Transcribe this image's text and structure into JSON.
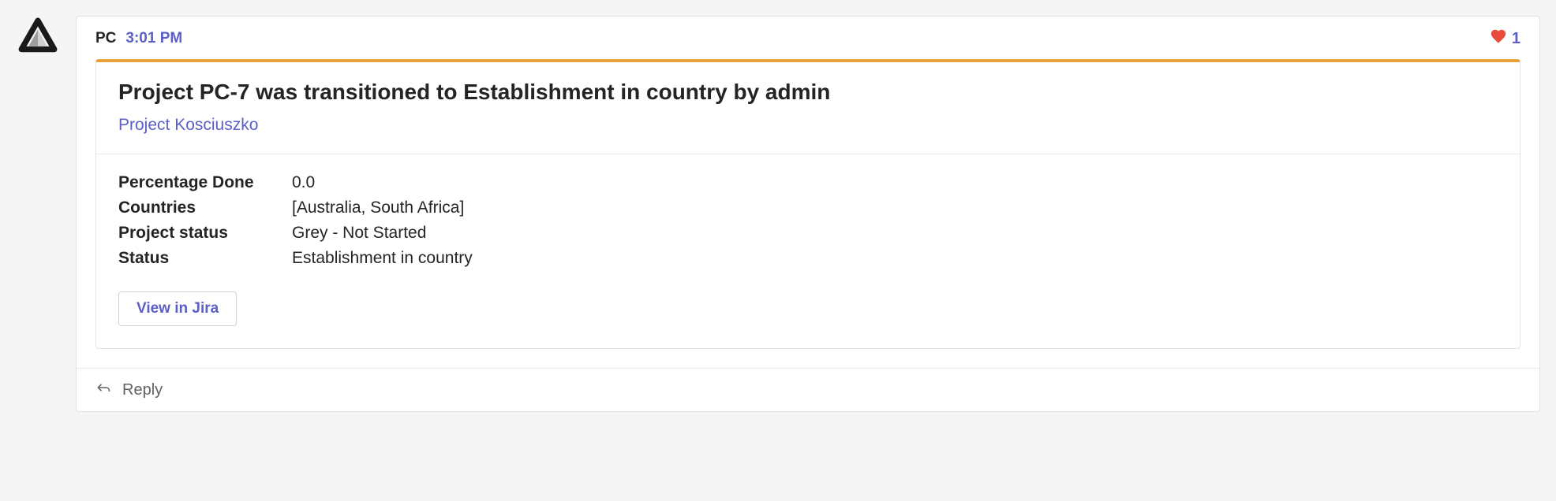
{
  "message": {
    "author": "PC",
    "time": "3:01 PM",
    "reactions": {
      "count": "1"
    }
  },
  "card": {
    "title": "Project PC-7 was transitioned to Establishment in country by admin",
    "project_link": "Project Kosciuszko",
    "details": [
      {
        "label": "Percentage Done",
        "value": "0.0"
      },
      {
        "label": "Countries",
        "value": "[Australia, South Africa]"
      },
      {
        "label": "Project status",
        "value": "Grey - Not Started"
      },
      {
        "label": "Status",
        "value": "Establishment in country"
      }
    ],
    "button_label": "View in Jira"
  },
  "reply": {
    "label": "Reply"
  }
}
